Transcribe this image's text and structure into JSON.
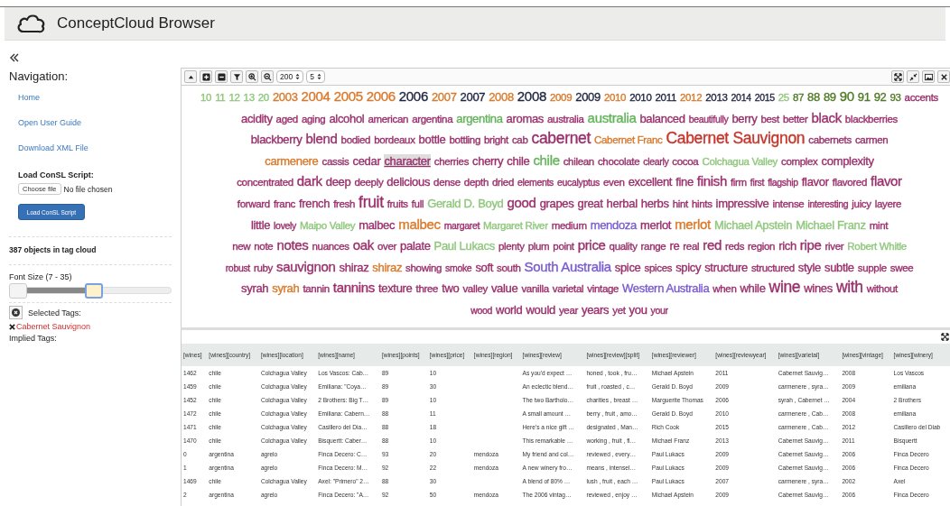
{
  "header": {
    "title": "ConceptCloud Browser"
  },
  "sidebar": {
    "heading": "Navigation:",
    "links": [
      "Home",
      "Open User Guide",
      "Download XML File"
    ],
    "script_label": "Load ConSL Script:",
    "file_button": "Choose file",
    "file_status": "No file chosen",
    "load_button": "Load ConSL Script",
    "object_count": "387 objects in tag cloud",
    "font_size_label": "Font Size (7 - 35)",
    "font_size_slider": {
      "handles": [
        {
          "level": 0
        },
        {
          "level": 0.53
        }
      ]
    },
    "selected_label": "Selected Tags:",
    "selected_tags": [
      "Cabernet Sauvignon"
    ],
    "implied_label": "Implied Tags:"
  },
  "toolbar": {
    "buttons": [
      {
        "kind": "collapse"
      },
      {
        "kind": "plus"
      },
      {
        "kind": "minus"
      },
      {
        "kind": "filter"
      },
      {
        "kind": "zoom-in"
      },
      {
        "kind": "zoom-out"
      }
    ],
    "selects": [
      {
        "value": "200"
      },
      {
        "value": "5"
      }
    ],
    "right_buttons": [
      {
        "kind": "fullscreen"
      },
      {
        "kind": "shrink"
      },
      {
        "kind": "image"
      },
      {
        "kind": "close"
      }
    ]
  },
  "tag_cloud": {
    "lines": [
      {
        "tags": [
          {
            "text": "10",
            "color": "#8fc77c",
            "kind": "s"
          },
          {
            "text": "11",
            "color": "#8fc77c",
            "kind": "s"
          },
          {
            "text": "12",
            "color": "#8fc77c",
            "kind": "s"
          },
          {
            "text": "13",
            "color": "#8fc77c",
            "kind": "s"
          },
          {
            "text": "20",
            "color": "#8fc77c",
            "kind": "s"
          },
          {
            "text": "2003",
            "color": "#d9792a",
            "kind": "m"
          },
          {
            "text": "2004",
            "color": "#d9792a",
            "kind": "l"
          },
          {
            "text": "2005",
            "color": "#d9792a",
            "kind": "l"
          },
          {
            "text": "2006",
            "color": "#d9792a",
            "kind": "l"
          },
          {
            "text": "2006",
            "color": "#1f2640",
            "kind": "l"
          },
          {
            "text": "2007",
            "color": "#d9792a",
            "kind": "m"
          },
          {
            "text": "2007",
            "color": "#1f2640",
            "kind": "m"
          },
          {
            "text": "2008",
            "color": "#d9792a",
            "kind": "m"
          },
          {
            "text": "2008",
            "color": "#1f2640",
            "kind": "l"
          },
          {
            "text": "2009",
            "color": "#d9792a",
            "kind": "s"
          },
          {
            "text": "2009",
            "color": "#1f2640",
            "kind": "m"
          },
          {
            "text": "2010",
            "color": "#d9792a",
            "kind": "s"
          },
          {
            "text": "2010",
            "color": "#1f2640",
            "kind": "s"
          },
          {
            "text": "2011",
            "color": "#1f2640",
            "kind": "s"
          },
          {
            "text": "2012",
            "color": "#d9792a",
            "kind": "s"
          },
          {
            "text": "2013",
            "color": "#1f2640",
            "kind": "s"
          },
          {
            "text": "2014",
            "color": "#1f2640",
            "kind": "xs"
          },
          {
            "text": "2015",
            "color": "#1f2640",
            "kind": "xs"
          },
          {
            "text": "25",
            "color": "#8fc77c",
            "kind": "s"
          },
          {
            "text": "87",
            "color": "#4f7a25",
            "kind": "s"
          },
          {
            "text": "88",
            "color": "#4f7a25",
            "kind": "m"
          },
          {
            "text": "89",
            "color": "#4f7a25",
            "kind": "m"
          },
          {
            "text": "90",
            "color": "#4f7a25",
            "kind": "l"
          },
          {
            "text": "91",
            "color": "#4f7a25",
            "kind": "m"
          },
          {
            "text": "92",
            "color": "#4f7a25",
            "kind": "m"
          },
          {
            "text": "93",
            "color": "#4f7a25",
            "kind": "s"
          },
          {
            "text": "accents",
            "color": "#9a2f6b",
            "kind": "s"
          }
        ]
      },
      {
        "tags": [
          {
            "text": "acidity",
            "color": "#9a2f6b",
            "kind": "m"
          },
          {
            "text": "aged",
            "color": "#9a2f6b",
            "kind": "s"
          },
          {
            "text": "aging",
            "color": "#9a2f6b",
            "kind": "s"
          },
          {
            "text": "alcohol",
            "color": "#9a2f6b",
            "kind": "m"
          },
          {
            "text": "american",
            "color": "#9a2f6b",
            "kind": "s"
          },
          {
            "text": "argentina",
            "color": "#9a2f6b",
            "kind": "s"
          },
          {
            "text": "argentina",
            "color": "#62b35a",
            "kind": "m"
          },
          {
            "text": "aromas",
            "color": "#9a2f6b",
            "kind": "m"
          },
          {
            "text": "australia",
            "color": "#9a2f6b",
            "kind": "s"
          },
          {
            "text": "australia",
            "color": "#62b35a",
            "kind": "l"
          },
          {
            "text": "balanced",
            "color": "#9a2f6b",
            "kind": "m"
          },
          {
            "text": "beautifully",
            "color": "#9a2f6b",
            "kind": "xs"
          },
          {
            "text": "berry",
            "color": "#9a2f6b",
            "kind": "m"
          },
          {
            "text": "best",
            "color": "#9a2f6b",
            "kind": "s"
          },
          {
            "text": "better",
            "color": "#9a2f6b",
            "kind": "s"
          },
          {
            "text": "black",
            "color": "#9a2f6b",
            "kind": "l"
          },
          {
            "text": "blackberries",
            "color": "#9a2f6b",
            "kind": "s"
          }
        ]
      },
      {
        "tags": [
          {
            "text": "blackberry",
            "color": "#9a2f6b",
            "kind": "m"
          },
          {
            "text": "blend",
            "color": "#9a2f6b",
            "kind": "l"
          },
          {
            "text": "bodied",
            "color": "#9a2f6b",
            "kind": "s"
          },
          {
            "text": "bordeaux",
            "color": "#9a2f6b",
            "kind": "s"
          },
          {
            "text": "bottle",
            "color": "#9a2f6b",
            "kind": "m"
          },
          {
            "text": "bottling",
            "color": "#9a2f6b",
            "kind": "s"
          },
          {
            "text": "bright",
            "color": "#9a2f6b",
            "kind": "s"
          },
          {
            "text": "cab",
            "color": "#9a2f6b",
            "kind": "s"
          },
          {
            "text": "cabernet",
            "color": "#9a2f6b",
            "kind": "xl"
          },
          {
            "text": "Cabernet Franc",
            "color": "#d9792a",
            "kind": "s"
          },
          {
            "text": "Cabernet Sauvignon",
            "color": "#c7352b",
            "kind": "xl"
          },
          {
            "text": "cabernets",
            "color": "#9a2f6b",
            "kind": "s"
          },
          {
            "text": "carmen",
            "color": "#9a2f6b",
            "kind": "s"
          }
        ]
      },
      {
        "tags": [
          {
            "text": "carmenere",
            "color": "#d9792a",
            "kind": "m"
          },
          {
            "text": "cassis",
            "color": "#9a2f6b",
            "kind": "s"
          },
          {
            "text": "cedar",
            "color": "#9a2f6b",
            "kind": "m"
          },
          {
            "text": "character",
            "color": "#9a2f6b",
            "kind": "m",
            "highlighted": true
          },
          {
            "text": "cherries",
            "color": "#9a2f6b",
            "kind": "s"
          },
          {
            "text": "cherry",
            "color": "#9a2f6b",
            "kind": "m"
          },
          {
            "text": "chile",
            "color": "#9a2f6b",
            "kind": "m"
          },
          {
            "text": "chile",
            "color": "#62b35a",
            "kind": "l"
          },
          {
            "text": "chilean",
            "color": "#9a2f6b",
            "kind": "s"
          },
          {
            "text": "chocolate",
            "color": "#9a2f6b",
            "kind": "s"
          },
          {
            "text": "clearly",
            "color": "#9a2f6b",
            "kind": "xs"
          },
          {
            "text": "cocoa",
            "color": "#9a2f6b",
            "kind": "s"
          },
          {
            "text": "Colchagua Valley",
            "color": "#8fc77c",
            "kind": "s"
          },
          {
            "text": "complex",
            "color": "#9a2f6b",
            "kind": "s"
          },
          {
            "text": "complexity",
            "color": "#9a2f6b",
            "kind": "m"
          }
        ]
      },
      {
        "tags": [
          {
            "text": "concentrated",
            "color": "#9a2f6b",
            "kind": "s"
          },
          {
            "text": "dark",
            "color": "#9a2f6b",
            "kind": "l"
          },
          {
            "text": "deep",
            "color": "#9a2f6b",
            "kind": "m"
          },
          {
            "text": "deeply",
            "color": "#9a2f6b",
            "kind": "s"
          },
          {
            "text": "delicious",
            "color": "#9a2f6b",
            "kind": "m"
          },
          {
            "text": "dense",
            "color": "#9a2f6b",
            "kind": "s"
          },
          {
            "text": "depth",
            "color": "#9a2f6b",
            "kind": "s"
          },
          {
            "text": "dried",
            "color": "#9a2f6b",
            "kind": "s"
          },
          {
            "text": "elements",
            "color": "#9a2f6b",
            "kind": "xs"
          },
          {
            "text": "eucalyptus",
            "color": "#9a2f6b",
            "kind": "xs"
          },
          {
            "text": "even",
            "color": "#9a2f6b",
            "kind": "s"
          },
          {
            "text": "excellent",
            "color": "#9a2f6b",
            "kind": "m"
          },
          {
            "text": "fine",
            "color": "#9a2f6b",
            "kind": "m"
          },
          {
            "text": "finish",
            "color": "#9a2f6b",
            "kind": "l"
          },
          {
            "text": "firm",
            "color": "#9a2f6b",
            "kind": "s"
          },
          {
            "text": "first",
            "color": "#9a2f6b",
            "kind": "xs"
          },
          {
            "text": "flagship",
            "color": "#9a2f6b",
            "kind": "xs"
          },
          {
            "text": "flavor",
            "color": "#9a2f6b",
            "kind": "m"
          },
          {
            "text": "flavored",
            "color": "#9a2f6b",
            "kind": "s"
          },
          {
            "text": "flavor",
            "color": "#9a2f6b",
            "kind": "l"
          }
        ]
      },
      {
        "tags": [
          {
            "text": "forward",
            "color": "#9a2f6b",
            "kind": "s"
          },
          {
            "text": "franc",
            "color": "#9a2f6b",
            "kind": "s"
          },
          {
            "text": "french",
            "color": "#9a2f6b",
            "kind": "m"
          },
          {
            "text": "fresh",
            "color": "#9a2f6b",
            "kind": "s"
          },
          {
            "text": "fruit",
            "color": "#9a2f6b",
            "kind": "xl"
          },
          {
            "text": "fruits",
            "color": "#9a2f6b",
            "kind": "s"
          },
          {
            "text": "full",
            "color": "#9a2f6b",
            "kind": "s"
          },
          {
            "text": "Gerald D. Boyd",
            "color": "#8fc77c",
            "kind": "m"
          },
          {
            "text": "good",
            "color": "#9a2f6b",
            "kind": "l"
          },
          {
            "text": "grapes",
            "color": "#9a2f6b",
            "kind": "m"
          },
          {
            "text": "great",
            "color": "#9a2f6b",
            "kind": "m"
          },
          {
            "text": "herbal",
            "color": "#9a2f6b",
            "kind": "m"
          },
          {
            "text": "herbs",
            "color": "#9a2f6b",
            "kind": "m"
          },
          {
            "text": "hint",
            "color": "#9a2f6b",
            "kind": "s"
          },
          {
            "text": "hints",
            "color": "#9a2f6b",
            "kind": "s"
          },
          {
            "text": "impressive",
            "color": "#9a2f6b",
            "kind": "m"
          },
          {
            "text": "intense",
            "color": "#9a2f6b",
            "kind": "s"
          },
          {
            "text": "interesting",
            "color": "#9a2f6b",
            "kind": "xs"
          },
          {
            "text": "juicy",
            "color": "#9a2f6b",
            "kind": "s"
          },
          {
            "text": "layere",
            "color": "#9a2f6b",
            "kind": "s"
          }
        ]
      },
      {
        "tags": [
          {
            "text": "little",
            "color": "#9a2f6b",
            "kind": "m"
          },
          {
            "text": "lovely",
            "color": "#9a2f6b",
            "kind": "xs"
          },
          {
            "text": "Maipo Valley",
            "color": "#8fc77c",
            "kind": "s"
          },
          {
            "text": "malbec",
            "color": "#9a2f6b",
            "kind": "m"
          },
          {
            "text": "malbec",
            "color": "#d9792a",
            "kind": "l"
          },
          {
            "text": "margaret",
            "color": "#9a2f6b",
            "kind": "xs"
          },
          {
            "text": "Margaret River",
            "color": "#8fc77c",
            "kind": "s"
          },
          {
            "text": "medium",
            "color": "#9a2f6b",
            "kind": "s"
          },
          {
            "text": "mendoza",
            "color": "#7a5ad1",
            "kind": "m"
          },
          {
            "text": "merlot",
            "color": "#9a2f6b",
            "kind": "m"
          },
          {
            "text": "merlot",
            "color": "#d9792a",
            "kind": "l"
          },
          {
            "text": "Michael Apstein",
            "color": "#8fc77c",
            "kind": "m"
          },
          {
            "text": "Michael Franz",
            "color": "#8fc77c",
            "kind": "m"
          },
          {
            "text": "mint",
            "color": "#9a2f6b",
            "kind": "s"
          }
        ]
      },
      {
        "tags": [
          {
            "text": "new",
            "color": "#9a2f6b",
            "kind": "s"
          },
          {
            "text": "note",
            "color": "#9a2f6b",
            "kind": "s"
          },
          {
            "text": "notes",
            "color": "#9a2f6b",
            "kind": "l"
          },
          {
            "text": "nuances",
            "color": "#9a2f6b",
            "kind": "s"
          },
          {
            "text": "oak",
            "color": "#9a2f6b",
            "kind": "l"
          },
          {
            "text": "over",
            "color": "#9a2f6b",
            "kind": "s"
          },
          {
            "text": "palate",
            "color": "#9a2f6b",
            "kind": "m"
          },
          {
            "text": "Paul Lukacs",
            "color": "#8fc77c",
            "kind": "m"
          },
          {
            "text": "plenty",
            "color": "#9a2f6b",
            "kind": "s"
          },
          {
            "text": "plum",
            "color": "#9a2f6b",
            "kind": "s"
          },
          {
            "text": "point",
            "color": "#9a2f6b",
            "kind": "s"
          },
          {
            "text": "price",
            "color": "#9a2f6b",
            "kind": "l"
          },
          {
            "text": "quality",
            "color": "#9a2f6b",
            "kind": "s"
          },
          {
            "text": "range",
            "color": "#9a2f6b",
            "kind": "s"
          },
          {
            "text": "re",
            "color": "#9a2f6b",
            "kind": "m"
          },
          {
            "text": "real",
            "color": "#9a2f6b",
            "kind": "s"
          },
          {
            "text": "red",
            "color": "#9a2f6b",
            "kind": "l"
          },
          {
            "text": "reds",
            "color": "#9a2f6b",
            "kind": "s"
          },
          {
            "text": "region",
            "color": "#9a2f6b",
            "kind": "s"
          },
          {
            "text": "rich",
            "color": "#9a2f6b",
            "kind": "m"
          },
          {
            "text": "ripe",
            "color": "#9a2f6b",
            "kind": "l"
          },
          {
            "text": "river",
            "color": "#9a2f6b",
            "kind": "s"
          },
          {
            "text": "Robert Whitle",
            "color": "#8fc77c",
            "kind": "s"
          }
        ]
      },
      {
        "tags": [
          {
            "text": "robust",
            "color": "#9a2f6b",
            "kind": "xs"
          },
          {
            "text": "ruby",
            "color": "#9a2f6b",
            "kind": "s"
          },
          {
            "text": "sauvignon",
            "color": "#9a2f6b",
            "kind": "l"
          },
          {
            "text": "shiraz",
            "color": "#9a2f6b",
            "kind": "m"
          },
          {
            "text": "shiraz",
            "color": "#d9792a",
            "kind": "m"
          },
          {
            "text": "showing",
            "color": "#9a2f6b",
            "kind": "s"
          },
          {
            "text": "smoke",
            "color": "#9a2f6b",
            "kind": "xs"
          },
          {
            "text": "soft",
            "color": "#9a2f6b",
            "kind": "m"
          },
          {
            "text": "south",
            "color": "#9a2f6b",
            "kind": "s"
          },
          {
            "text": "South Australia",
            "color": "#7a5ad1",
            "kind": "l"
          },
          {
            "text": "spice",
            "color": "#9a2f6b",
            "kind": "m"
          },
          {
            "text": "spices",
            "color": "#9a2f6b",
            "kind": "s"
          },
          {
            "text": "spicy",
            "color": "#9a2f6b",
            "kind": "m"
          },
          {
            "text": "structure",
            "color": "#9a2f6b",
            "kind": "m"
          },
          {
            "text": "structured",
            "color": "#9a2f6b",
            "kind": "s"
          },
          {
            "text": "style",
            "color": "#9a2f6b",
            "kind": "m"
          },
          {
            "text": "subtle",
            "color": "#9a2f6b",
            "kind": "m"
          },
          {
            "text": "supple",
            "color": "#9a2f6b",
            "kind": "s"
          },
          {
            "text": "swee",
            "color": "#9a2f6b",
            "kind": "s"
          }
        ]
      },
      {
        "tags": [
          {
            "text": "syrah",
            "color": "#9a2f6b",
            "kind": "m"
          },
          {
            "text": "syrah",
            "color": "#d9792a",
            "kind": "m"
          },
          {
            "text": "tannin",
            "color": "#9a2f6b",
            "kind": "s"
          },
          {
            "text": "tannins",
            "color": "#9a2f6b",
            "kind": "l"
          },
          {
            "text": "texture",
            "color": "#9a2f6b",
            "kind": "m"
          },
          {
            "text": "three",
            "color": "#9a2f6b",
            "kind": "s"
          },
          {
            "text": "two",
            "color": "#9a2f6b",
            "kind": "m"
          },
          {
            "text": "valley",
            "color": "#9a2f6b",
            "kind": "s"
          },
          {
            "text": "value",
            "color": "#9a2f6b",
            "kind": "m"
          },
          {
            "text": "vanilla",
            "color": "#9a2f6b",
            "kind": "s"
          },
          {
            "text": "varietal",
            "color": "#9a2f6b",
            "kind": "s"
          },
          {
            "text": "vintage",
            "color": "#9a2f6b",
            "kind": "s"
          },
          {
            "text": "Western Australia",
            "color": "#7a5ad1",
            "kind": "m"
          },
          {
            "text": "when",
            "color": "#9a2f6b",
            "kind": "s"
          },
          {
            "text": "while",
            "color": "#9a2f6b",
            "kind": "m"
          },
          {
            "text": "wine",
            "color": "#9a2f6b",
            "kind": "xl"
          },
          {
            "text": "wines",
            "color": "#9a2f6b",
            "kind": "m"
          },
          {
            "text": "with",
            "color": "#9a2f6b",
            "kind": "xl"
          },
          {
            "text": "without",
            "color": "#9a2f6b",
            "kind": "s"
          }
        ]
      },
      {
        "tags": [
          {
            "text": "wood",
            "color": "#9a2f6b",
            "kind": "xs"
          },
          {
            "text": "world",
            "color": "#9a2f6b",
            "kind": "m"
          },
          {
            "text": "would",
            "color": "#9a2f6b",
            "kind": "m"
          },
          {
            "text": "year",
            "color": "#9a2f6b",
            "kind": "s"
          },
          {
            "text": "years",
            "color": "#9a2f6b",
            "kind": "m"
          },
          {
            "text": "yet",
            "color": "#9a2f6b",
            "kind": "s"
          },
          {
            "text": "you",
            "color": "#9a2f6b",
            "kind": "m"
          },
          {
            "text": "your",
            "color": "#9a2f6b",
            "kind": "xs"
          }
        ]
      }
    ]
  },
  "table": {
    "columns": [
      "[wines]",
      "[wines][country]",
      "[wines][location]",
      "[wines][name]",
      "[wines][points]",
      "[wines][price]",
      "[wines][region]",
      "[wines][review]",
      "[wines][review][split]",
      "[wines][reviewer]",
      "[wines][reviewyear]",
      "[wines][varietal]",
      "[wines][vintage]",
      "[wines][winery]"
    ],
    "rows": [
      [
        "1462",
        "chile",
        "Colchagua Valley",
        "Los Vascos: Cab…",
        "89",
        "10",
        null,
        "As you'd expect …",
        "honed , took , fru…",
        "Michael Apstein",
        "2011",
        "Cabernet Sauvig…",
        "2008",
        "Los Vascos"
      ],
      [
        "1459",
        "chile",
        "Colchagua Valley",
        "Emiliana: \"Coya…",
        "89",
        "30",
        null,
        "An eclectic blend…",
        "fruit , roasted , c…",
        "Gerald D. Boyd",
        "2009",
        "carmenere , syra…",
        "2009",
        "emiliana"
      ],
      [
        "1452",
        "chile",
        "Colchagua Valley",
        "2 Brothers: Big T…",
        "89",
        "10",
        null,
        "The two Bartholo…",
        "charities , breast …",
        "Marguerite Thomas",
        "2006",
        "syrah , Cabernet …",
        "2004",
        "2 Brothers"
      ],
      [
        "1472",
        "chile",
        "Colchagua Valley",
        "Emiliana: Cabern…",
        "88",
        "11",
        null,
        "A small amount …",
        "berry , fruit , amo…",
        "Gerald D. Boyd",
        "2010",
        "carmenere , Cab…",
        "2008",
        "emiliana"
      ],
      [
        "1471",
        "chile",
        "Colchagua Valley",
        "Casillero del Dia…",
        "88",
        "18",
        null,
        "Here's a nice gift …",
        "designated , Man…",
        "Rich Cook",
        "2015",
        "carmenere , Cab…",
        "2012",
        "Casillero del Diab"
      ],
      [
        "1470",
        "chile",
        "Colchagua Valley",
        "Bisquertt: Caber…",
        "88",
        "10",
        null,
        "This remarkable …",
        "working , fruit , fl…",
        "Michael Franz",
        "2013",
        "Cabernet Sauvig…",
        "2011",
        "Bisquertt"
      ],
      [
        "0",
        "argentina",
        "agrelo",
        "Finca Decero: C…",
        "93",
        "20",
        "mendoza",
        "My friend and col…",
        "reviewed , every…",
        "Paul Lukacs",
        "2009",
        "Cabernet Sauvig…",
        "2006",
        "Finca Decero"
      ],
      [
        "1",
        "argentina",
        "agrelo",
        "Finca Decero: M…",
        "92",
        "22",
        "mendoza",
        "A new winery fro…",
        "means , intensel…",
        "Paul Lukacs",
        "2009",
        "Cabernet Sauvig…",
        "2006",
        "Finca Decero"
      ],
      [
        "1469",
        "chile",
        "Colchagua Valley",
        "Axel: \"Primero\" 2…",
        "88",
        "30",
        null,
        "A blend of 80% …",
        "lush , fruit , each …",
        "Paul Lukacs",
        "2007",
        "carmenere , syra…",
        "2002",
        "Axel"
      ],
      [
        "2",
        "argentina",
        "agrelo",
        "Finca Decero: \"A…",
        "92",
        "50",
        "mendoza",
        "The 2006 vintag…",
        "reviewed , enjoy …",
        "Michael Apstein",
        "2009",
        "Cabernet Sauvig…",
        "2006",
        "Finca Decero"
      ]
    ]
  }
}
